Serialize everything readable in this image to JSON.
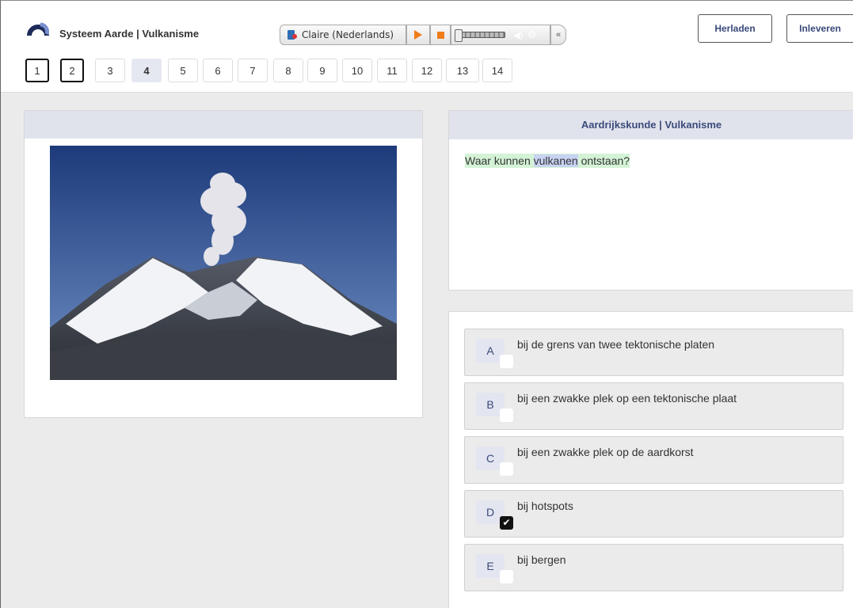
{
  "header": {
    "app_title": "Systeem Aarde | Vulkanisme",
    "tts": {
      "voice": "Claire (Nederlands)",
      "collapse": "«"
    },
    "reload_label": "Herladen",
    "submit_label": "Inleveren"
  },
  "question_nav": {
    "questions": [
      {
        "label": "1",
        "state": "answered"
      },
      {
        "label": "2",
        "state": "answered"
      },
      {
        "label": "3",
        "state": "default"
      },
      {
        "label": "4",
        "state": "current"
      },
      {
        "label": "5",
        "state": "default"
      },
      {
        "label": "6",
        "state": "default"
      },
      {
        "label": "7",
        "state": "default"
      },
      {
        "label": "8",
        "state": "default"
      },
      {
        "label": "9",
        "state": "default"
      },
      {
        "label": "10",
        "state": "default"
      },
      {
        "label": "11",
        "state": "default"
      },
      {
        "label": "12",
        "state": "default"
      },
      {
        "label": "13",
        "state": "default"
      },
      {
        "label": "14",
        "state": "default"
      }
    ]
  },
  "question": {
    "panel_title": "Aardrijkskunde | Vulkanisme",
    "text_before": "Waar kunnen ",
    "keyword": "vulkanen",
    "text_after": " ontstaan?"
  },
  "answers": [
    {
      "letter": "A",
      "text": "bij de grens van twee tektonische platen",
      "checked": false
    },
    {
      "letter": "B",
      "text": "bij een zwakke plek op een tektonische plaat",
      "checked": false
    },
    {
      "letter": "C",
      "text": "bij een zwakke plek op de aardkorst",
      "checked": false
    },
    {
      "letter": "D",
      "text": "bij hotspots",
      "checked": true
    },
    {
      "letter": "E",
      "text": "bij bergen",
      "checked": false
    }
  ],
  "colors": {
    "accent": "#3a4a7a",
    "panel_header": "#e1e3ec",
    "tts_orange": "#ef7d1a",
    "highlight_green": "#d4f3d6",
    "highlight_blue": "#c8d3f3"
  }
}
